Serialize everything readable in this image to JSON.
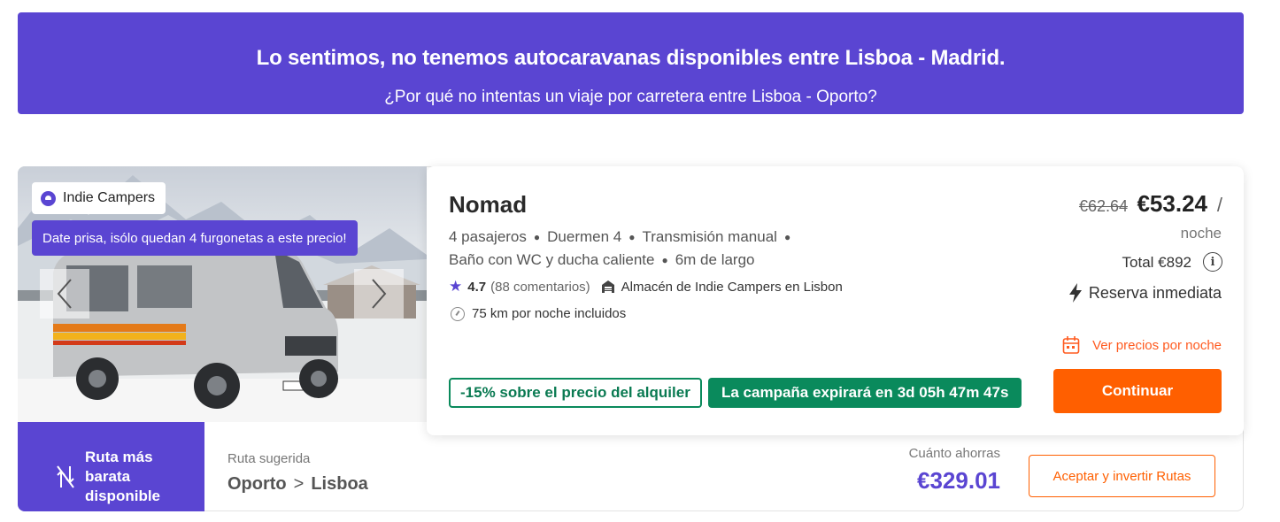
{
  "banner": {
    "title": "Lo sentimos, no tenemos autocaravanas disponibles entre Lisboa - Madrid.",
    "subtitle": "¿Por qué no intentas un viaje por carretera entre Lisboa - Oporto?"
  },
  "listing": {
    "brand": "Indie Campers",
    "hurry_message": "Date prisa, isólo quedan 4 furgonetas a este precio!",
    "model": "Nomad",
    "specs": [
      "4 pasajeros",
      "Duermen 4",
      "Transmisión manual",
      "Baño con WC y ducha caliente",
      "6m de largo"
    ],
    "rating": "4.7",
    "reviews": "(88 comentarios)",
    "depot": "Almacén de Indie Campers en Lisbon",
    "km_included": "75 km por noche incluidos",
    "discount_badge": "-15% sobre el precio del alquiler",
    "campaign_text": "La campaña expirará en",
    "campaign_timer": "3d 05h 47m 47s",
    "price_old": "€62.64",
    "price_new": "€53.24",
    "price_slash": "/",
    "price_unit": "noche",
    "total": "Total €892",
    "instant_booking": "Reserva inmediata",
    "nightly_prices_link": "Ver precios por noche",
    "continue_label": "Continuar"
  },
  "route_suggestion": {
    "badge_text": "Ruta más barata disponible",
    "suggested_label": "Ruta sugerida",
    "from": "Oporto",
    "separator": ">",
    "to": "Lisboa",
    "savings_label": "Cuánto ahorras",
    "savings_amount": "€329.01",
    "accept_label": "Aceptar y invertir Rutas"
  },
  "colors": {
    "brand_purple": "#5a45d2",
    "accent_orange": "#ff5f00",
    "promo_green": "#0a8a5c"
  },
  "icons": [
    "indie-campers-logo-icon",
    "chevron-left-icon",
    "chevron-right-icon",
    "star-icon",
    "depot-icon",
    "gauge-icon",
    "info-icon",
    "lightning-icon",
    "calendar-icon",
    "route-swap-icon"
  ]
}
